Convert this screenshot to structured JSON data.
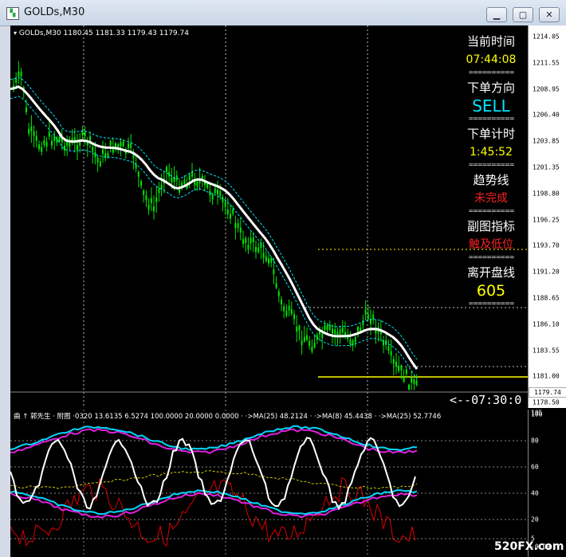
{
  "window": {
    "title": "GOLDs,M30",
    "buttons": {
      "minimize": "▁",
      "restore": "▢",
      "close": "✕"
    }
  },
  "chart": {
    "symbol_info": "GOLDs,M30  1180.45 1181.33 1179.43 1179.74",
    "price_labels": [
      "1214.05",
      "1211.55",
      "1208.95",
      "1206.40",
      "1203.85",
      "1201.35",
      "1198.80",
      "1196.25",
      "1193.70",
      "1191.20",
      "1188.65",
      "1186.10",
      "1183.55",
      "1181.00",
      "1178.50"
    ],
    "current_price": "1179.74",
    "sub_labels": [
      "105",
      "100",
      "80",
      "60",
      "40",
      "20",
      "5",
      "-0.00"
    ],
    "sub_info": "曲 ↑ 郭先生 · 附图 ·0320 13.6135 6.5274 100.0000 20.0000 0.0000   · ·>MA(25) 48.2124 · ·>MA(8) 45.4438 · ·>MA(25) 52.7746",
    "arrow_note": "<--07:30:0",
    "colors": {
      "candle": "#00e600",
      "ma": "#ffffff",
      "band": "#00e5ff",
      "hline": "#ffff00"
    }
  },
  "panel": {
    "items": [
      {
        "label": "当前时间",
        "value": "07:44:08",
        "color": "#ffff00"
      },
      {
        "label": "下单方向",
        "value": "SELL",
        "color": "#00e5ff"
      },
      {
        "label": "下单计时",
        "value": "1:45:52",
        "color": "#ffff00"
      },
      {
        "label": "趋势线",
        "value": "未完成",
        "color": "#ff2020"
      },
      {
        "label": "副图指标",
        "value": "触及低位",
        "color": "#ff2020"
      },
      {
        "label": "离开盘线",
        "value": "605",
        "color": "#ffff00"
      }
    ],
    "divider": "=========="
  },
  "watermark": "520FX.com"
}
